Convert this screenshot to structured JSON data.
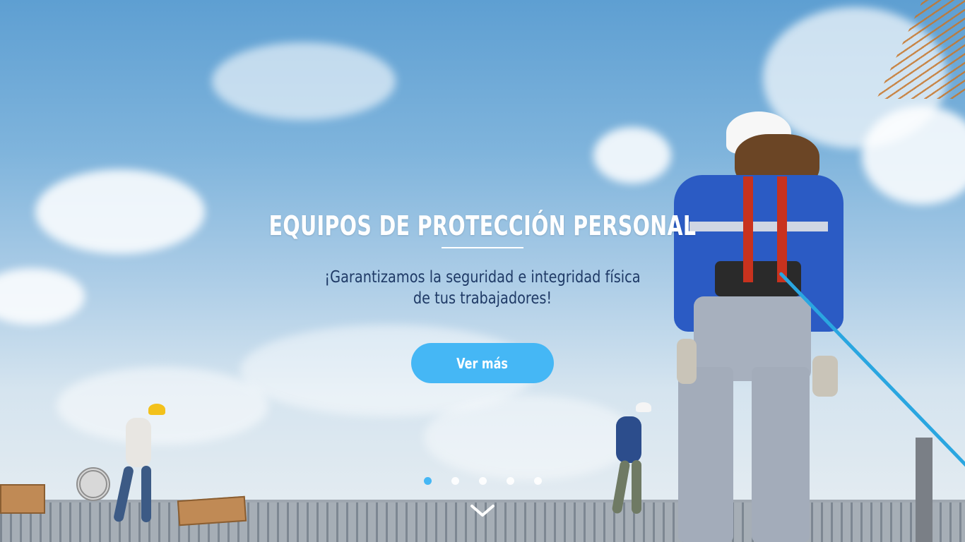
{
  "hero": {
    "title": "EQUIPOS DE PROTECCIÓN PERSONAL",
    "subtitle_line1": "¡Garantizamos la seguridad e integridad física",
    "subtitle_line2": "de tus trabajadores!",
    "cta_label": "Ver más"
  },
  "carousel": {
    "slide_count": 5,
    "active_index": 0,
    "scroll_icon": "chevron-down-icon"
  },
  "colors": {
    "accent": "#45b7f5",
    "subtitle": "#1f3a66",
    "title": "#ffffff"
  }
}
